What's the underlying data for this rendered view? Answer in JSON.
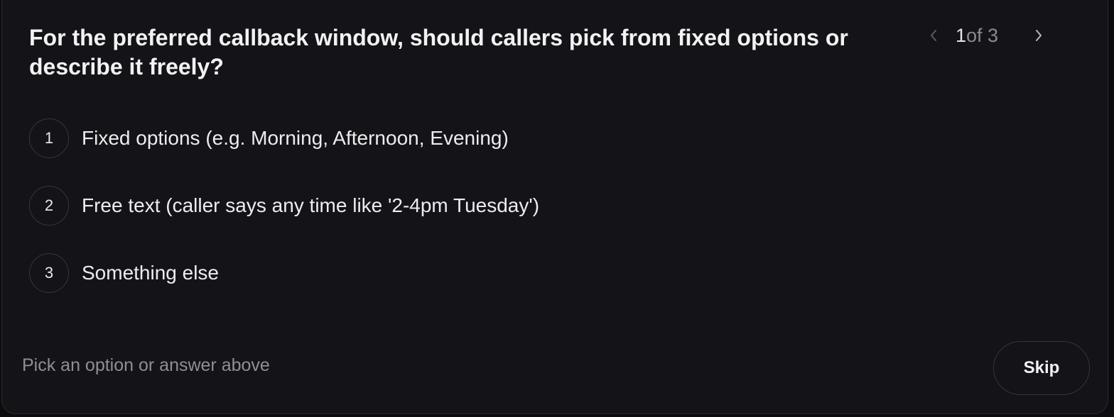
{
  "question": {
    "text": "For the preferred callback window, should callers pick from fixed options or describe it freely?"
  },
  "pager": {
    "current": "1",
    "total_text": "of 3",
    "prev_icon": "chevron-left-icon",
    "next_icon": "chevron-right-icon"
  },
  "options": [
    {
      "number": "1",
      "label": "Fixed options (e.g. Morning, Afternoon, Evening)"
    },
    {
      "number": "2",
      "label": "Free text (caller says any time like '2-4pm Tuesday')"
    },
    {
      "number": "3",
      "label": "Something else"
    }
  ],
  "footer": {
    "hint": "Pick an option or answer above",
    "skip_label": "Skip"
  },
  "colors": {
    "card_background": "#141418",
    "text_primary": "#f2f2f4",
    "text_muted": "#8e8e94"
  }
}
